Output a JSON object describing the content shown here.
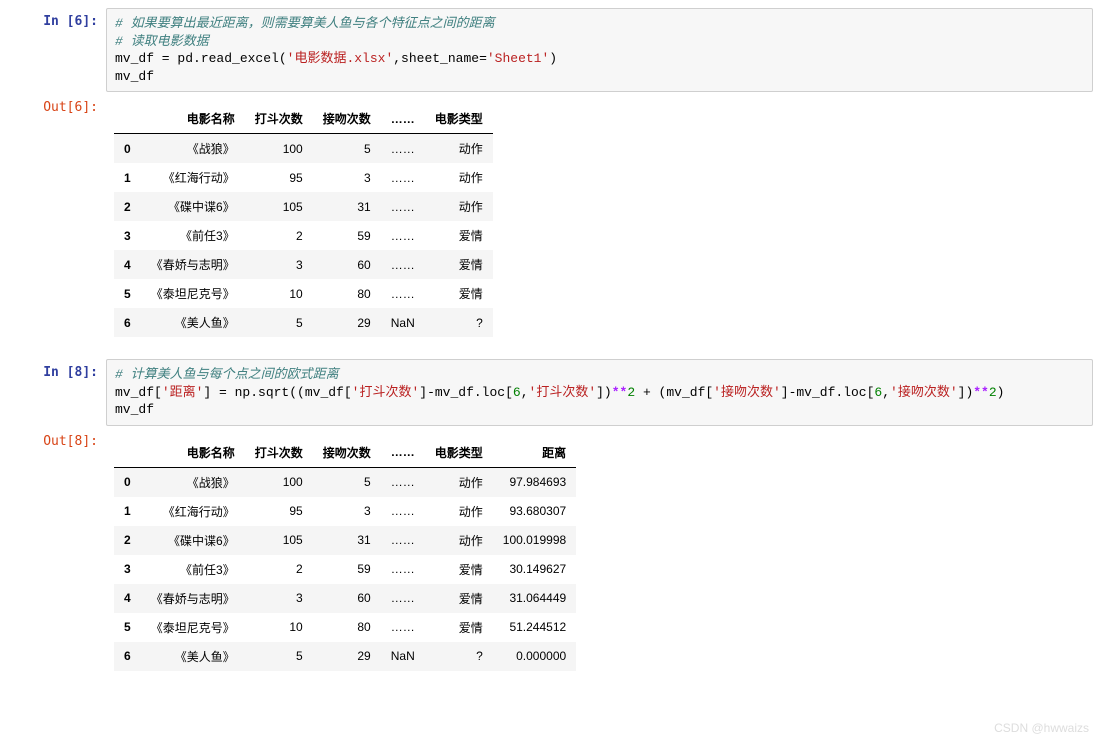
{
  "cells": [
    {
      "in_prompt": "In  [6]:",
      "out_prompt": "Out[6]:",
      "code": [
        {
          "t": "comment",
          "v": "# 如果要算出最近距离，则需要算美人鱼与各个特征点之间的距离"
        },
        {
          "t": "nl"
        },
        {
          "t": "comment",
          "v": "# 读取电影数据"
        },
        {
          "t": "nl"
        },
        {
          "t": "plain",
          "v": "mv_df = pd.read_excel("
        },
        {
          "t": "str",
          "v": "'电影数据.xlsx'"
        },
        {
          "t": "plain",
          "v": ",sheet_name="
        },
        {
          "t": "str",
          "v": "'Sheet1'"
        },
        {
          "t": "plain",
          "v": ")"
        },
        {
          "t": "nl"
        },
        {
          "t": "plain",
          "v": "mv_df"
        }
      ],
      "table": {
        "headers": [
          "",
          "电影名称",
          "打斗次数",
          "接吻次数",
          "……",
          "电影类型"
        ],
        "rows": [
          [
            "0",
            "《战狼》",
            "100",
            "5",
            "……",
            "动作"
          ],
          [
            "1",
            "《红海行动》",
            "95",
            "3",
            "……",
            "动作"
          ],
          [
            "2",
            "《碟中谍6》",
            "105",
            "31",
            "……",
            "动作"
          ],
          [
            "3",
            "《前任3》",
            "2",
            "59",
            "……",
            "爱情"
          ],
          [
            "4",
            "《春娇与志明》",
            "3",
            "60",
            "……",
            "爱情"
          ],
          [
            "5",
            "《泰坦尼克号》",
            "10",
            "80",
            "……",
            "爱情"
          ],
          [
            "6",
            "《美人鱼》",
            "5",
            "29",
            "NaN",
            "?"
          ]
        ]
      }
    },
    {
      "in_prompt": "In  [8]:",
      "out_prompt": "Out[8]:",
      "code": [
        {
          "t": "comment",
          "v": "# 计算美人鱼与每个点之间的欧式距离"
        },
        {
          "t": "nl"
        },
        {
          "t": "plain",
          "v": "mv_df["
        },
        {
          "t": "str",
          "v": "'距离'"
        },
        {
          "t": "plain",
          "v": "] = np.sqrt((mv_df["
        },
        {
          "t": "str",
          "v": "'打斗次数'"
        },
        {
          "t": "plain",
          "v": "]-mv_df.loc["
        },
        {
          "t": "num",
          "v": "6"
        },
        {
          "t": "plain",
          "v": ","
        },
        {
          "t": "str",
          "v": "'打斗次数'"
        },
        {
          "t": "plain",
          "v": "])"
        },
        {
          "t": "op",
          "v": "**"
        },
        {
          "t": "num",
          "v": "2"
        },
        {
          "t": "plain",
          "v": " + (mv_df["
        },
        {
          "t": "str",
          "v": "'接吻次数'"
        },
        {
          "t": "plain",
          "v": "]-mv_df.loc["
        },
        {
          "t": "num",
          "v": "6"
        },
        {
          "t": "plain",
          "v": ","
        },
        {
          "t": "str",
          "v": "'接吻次数'"
        },
        {
          "t": "plain",
          "v": "])"
        },
        {
          "t": "op",
          "v": "**"
        },
        {
          "t": "num",
          "v": "2"
        },
        {
          "t": "plain",
          "v": ")"
        },
        {
          "t": "nl"
        },
        {
          "t": "plain",
          "v": "mv_df"
        }
      ],
      "table": {
        "headers": [
          "",
          "电影名称",
          "打斗次数",
          "接吻次数",
          "……",
          "电影类型",
          "距离"
        ],
        "rows": [
          [
            "0",
            "《战狼》",
            "100",
            "5",
            "……",
            "动作",
            "97.984693"
          ],
          [
            "1",
            "《红海行动》",
            "95",
            "3",
            "……",
            "动作",
            "93.680307"
          ],
          [
            "2",
            "《碟中谍6》",
            "105",
            "31",
            "……",
            "动作",
            "100.019998"
          ],
          [
            "3",
            "《前任3》",
            "2",
            "59",
            "……",
            "爱情",
            "30.149627"
          ],
          [
            "4",
            "《春娇与志明》",
            "3",
            "60",
            "……",
            "爱情",
            "31.064449"
          ],
          [
            "5",
            "《泰坦尼克号》",
            "10",
            "80",
            "……",
            "爱情",
            "51.244512"
          ],
          [
            "6",
            "《美人鱼》",
            "5",
            "29",
            "NaN",
            "?",
            "0.000000"
          ]
        ]
      }
    }
  ],
  "watermark": "CSDN @hwwaizs"
}
